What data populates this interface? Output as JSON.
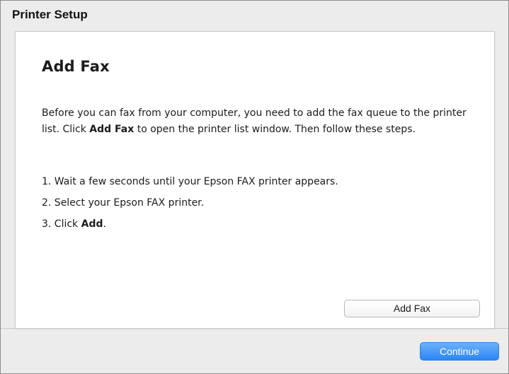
{
  "window": {
    "title": "Printer Setup"
  },
  "panel": {
    "title": "Add Fax",
    "intro_parts": [
      "Before you can fax from your computer, you need to add the fax queue to the printer list. Click ",
      "Add Fax",
      " to open the printer list window. Then follow these steps."
    ],
    "steps": [
      {
        "text": "1. Wait a few seconds until your Epson FAX printer appears.",
        "bold": ""
      },
      {
        "text": "2. Select your Epson FAX printer.",
        "bold": ""
      },
      {
        "text": "3. Click ",
        "bold": "Add",
        "suffix": "."
      }
    ],
    "add_fax_button_label": "Add Fax"
  },
  "footer": {
    "continue_label": "Continue"
  },
  "colors": {
    "accent": "#2b86f5"
  }
}
